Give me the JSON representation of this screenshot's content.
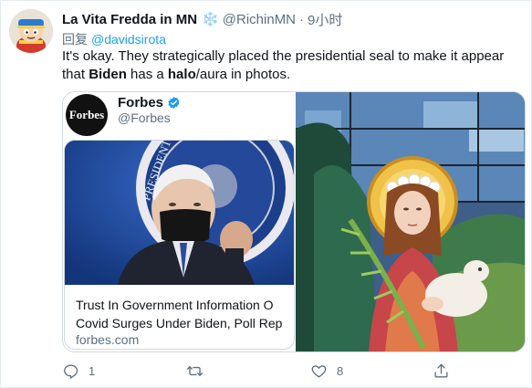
{
  "author": {
    "display_name": "La Vita Fredda in MN",
    "badge_glyph": "❄️",
    "handle": "@RichinMN",
    "separator": "·",
    "time": "9小时"
  },
  "reply": {
    "prefix": "回复",
    "user": "@davidsirota"
  },
  "text": {
    "part1": "It's okay. They strategically placed the presidential seal to make it appear that ",
    "bold1": "Biden",
    "part2": " has a ",
    "bold2": "halo",
    "part3": "/aura in photos."
  },
  "embedded": {
    "logo_text": "Forbes",
    "name": "Forbes",
    "handle": "@Forbes",
    "card_title_line1": "Trust In Government Information O",
    "card_title_line2": "Covid Surges Under Biden, Poll Rep",
    "card_domain": "forbes.com"
  },
  "actions": {
    "reply_count": "1",
    "retweet_count": "",
    "like_count": "8"
  },
  "colors": {
    "link_blue": "#1da1f2",
    "secondary_text": "#5b7083",
    "verified_blue": "#1d9bf0",
    "card_background_blue": "#1a4aa8"
  },
  "icons": {
    "verified": "verified-badge-icon",
    "reply": "reply-icon",
    "retweet": "retweet-icon",
    "like": "heart-icon",
    "share": "share-icon"
  }
}
